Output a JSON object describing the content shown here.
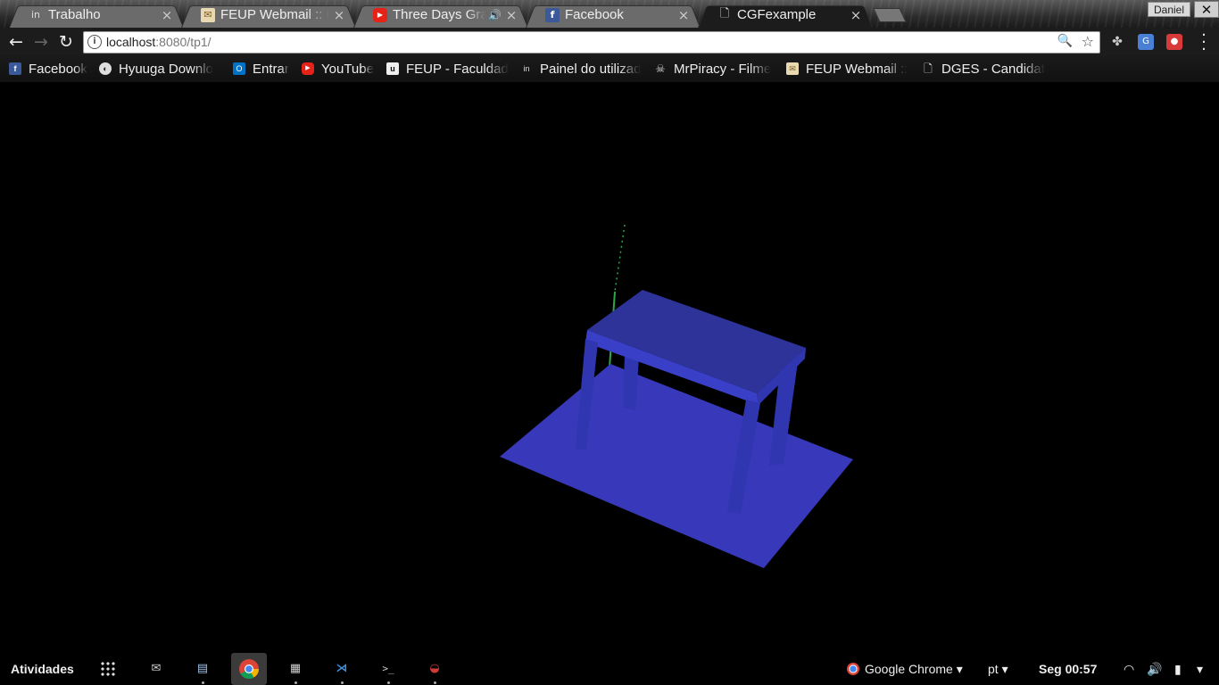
{
  "browser": {
    "tabs": [
      {
        "title": "Trabalho",
        "icon": "onedrive-icon",
        "active": false
      },
      {
        "title": "FEUP Webmail :: En",
        "icon": "mail-icon",
        "active": false
      },
      {
        "title": "Three Days Grac",
        "icon": "youtube-icon",
        "active": false,
        "audio": "🔊"
      },
      {
        "title": "Facebook",
        "icon": "facebook-icon",
        "active": false
      },
      {
        "title": "CGFexample",
        "icon": "page-icon",
        "active": true
      }
    ],
    "tab_close_glyph": "×",
    "profile_name": "Daniel",
    "window_close_glyph": "✕",
    "url_host": "localhost",
    "url_rest": ":8080/tp1/",
    "info_glyph": "i",
    "zoom_glyph": "🔍",
    "star_glyph": "☆"
  },
  "nav": {
    "back": "←",
    "forward": "→",
    "reload": "↻"
  },
  "bookmarks": [
    {
      "label": "Facebook",
      "icon": "facebook-icon",
      "color": "#3b5998",
      "glyph": "f"
    },
    {
      "label": "Hyuuga Downlo",
      "icon": "hyuuga-icon",
      "color": "#555555",
      "glyph": "◐"
    },
    {
      "label": "Entrar",
      "icon": "outlook-icon",
      "color": "#0072c6",
      "glyph": "O"
    },
    {
      "label": "YouTube",
      "icon": "youtube-icon",
      "color": "#e62117",
      "glyph": "▶"
    },
    {
      "label": "FEUP - Faculdad",
      "icon": "feup-icon",
      "color": "#333333",
      "glyph": "u"
    },
    {
      "label": "Painel do utilizad",
      "icon": "onedrive-icon",
      "color": "#444444",
      "glyph": "in"
    },
    {
      "label": "MrPiracy - Filme",
      "icon": "mrpiracy-icon",
      "color": "#222222",
      "glyph": "☠"
    },
    {
      "label": "FEUP Webmail ::",
      "icon": "mail-icon",
      "color": "#c8a96a",
      "glyph": "✉"
    },
    {
      "label": "DGES - Candidat",
      "icon": "page-icon",
      "color": "#111111",
      "glyph": "🗋"
    }
  ],
  "scene": {
    "floor_color": "#3838ba",
    "table_top_color": "#2e339a",
    "table_side_color": "#3a3fc8",
    "leg_color": "#3036b0",
    "axis_y_color": "#2aa84a"
  },
  "taskbar": {
    "activities_label": "Atividades",
    "app_menu_label": "Google Chrome ▾",
    "language_label": "pt ▾",
    "clock": "Seg 00:57",
    "launchers": [
      {
        "icon": "mail-client-icon",
        "glyph": "✉",
        "color": "#cfcfcf"
      },
      {
        "icon": "document-viewer-icon",
        "glyph": "▤",
        "color": "#dfe8f5"
      },
      {
        "icon": "chrome-icon",
        "glyph": "◉",
        "color": "#ffffff",
        "active": true
      },
      {
        "icon": "file-cabinet-icon",
        "glyph": "▦",
        "color": "#d0d0d0"
      },
      {
        "icon": "vscode-icon",
        "glyph": "⋊",
        "color": "#3f90d8"
      },
      {
        "icon": "terminal-icon",
        "glyph": ">_",
        "color": "#cfcfcf"
      },
      {
        "icon": "eclipse-icon",
        "glyph": "◒",
        "color": "#d23a3a"
      }
    ],
    "tray_wifi": "◠",
    "tray_volume": "🔊",
    "tray_battery": "▮",
    "tray_menu": "▾"
  }
}
